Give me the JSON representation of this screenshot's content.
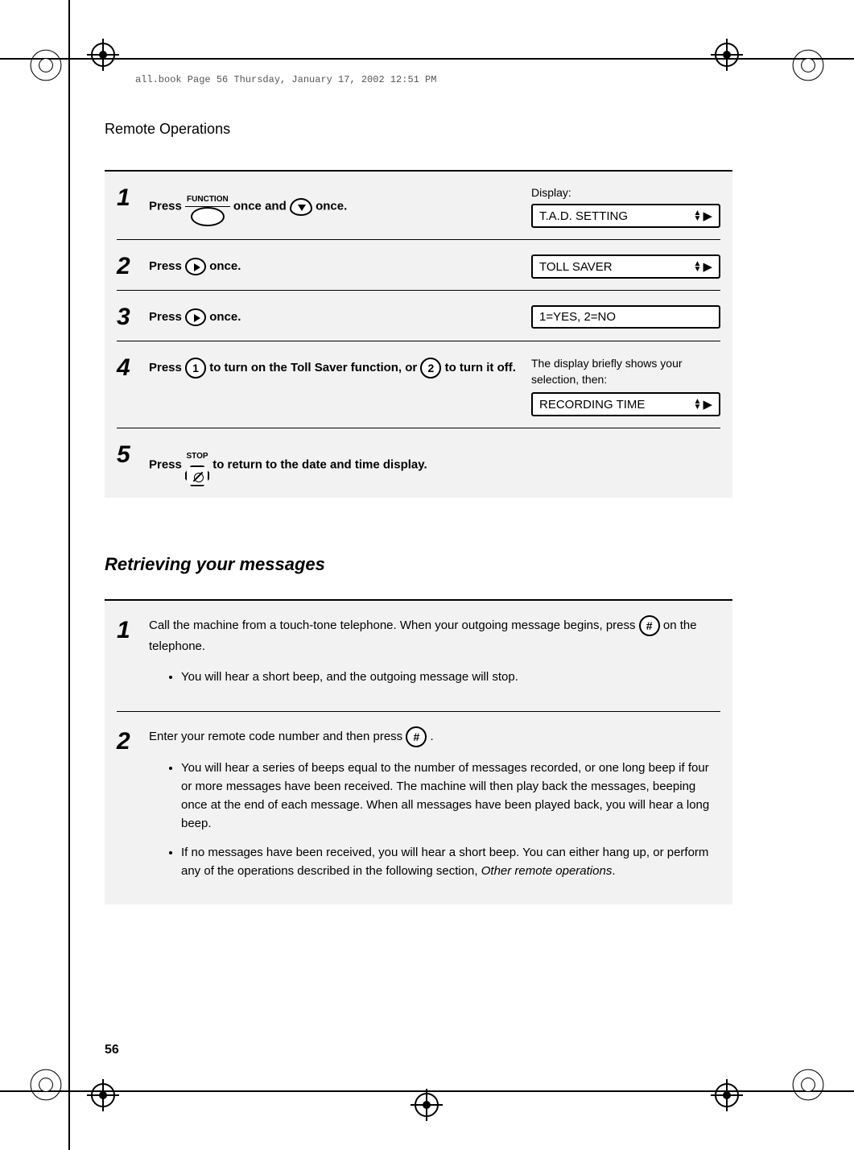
{
  "header_line": "all.book  Page 56  Thursday, January 17, 2002  12:51 PM",
  "section_title": "Remote Operations",
  "steps": [
    {
      "num": "1",
      "text_parts": [
        "Press ",
        "FUNCTION",
        " once and ",
        "ARROW_DOWN",
        " once."
      ],
      "display_label": "Display:",
      "lcd": "T.A.D. SETTING",
      "has_arrows": true
    },
    {
      "num": "2",
      "text_parts": [
        "Press ",
        "ARROW_RIGHT",
        " once."
      ],
      "lcd": "TOLL SAVER",
      "has_arrows": true
    },
    {
      "num": "3",
      "text_parts": [
        "Press ",
        "ARROW_RIGHT",
        " once."
      ],
      "lcd": "1=YES, 2=NO",
      "has_arrows": false
    },
    {
      "num": "4",
      "pre_text": "The display briefly shows your selection, then:",
      "body_a": "Press ",
      "key1": "1",
      "body_b": " to turn on the Toll Saver function, or ",
      "key2": "2",
      "body_c": " to turn it off.",
      "lcd": "RECORDING TIME",
      "has_arrows": true
    },
    {
      "num": "5",
      "body_a": "Press ",
      "stop_label": "STOP",
      "body_b": " to return to the date and time display."
    }
  ],
  "section_subtitle": "Retrieving your messages",
  "sub_steps": [
    {
      "num": "1",
      "body_a": "Call the machine from a touch-tone telephone. When your outgoing message begins, press ",
      "key": "#",
      "body_b": " on the telephone.",
      "bullets": [
        "You will hear a short beep, and the outgoing message will stop."
      ]
    },
    {
      "num": "2",
      "body_a": "Enter your remote code number and then press ",
      "key": "#",
      "body_b": ".",
      "bullets": [
        "You will hear a series of beeps equal to the number of messages recorded, or one long beep if four or more messages have been received. The machine will then play back the messages, beeping once at the end of each message. When all messages have been played back, you will hear a long beep.",
        "If no messages have been received, you will hear a short beep. You can either hang up, or perform any of the operations described in the following section, Other remote operations."
      ],
      "italic_len": 23
    }
  ],
  "page_num": "56"
}
